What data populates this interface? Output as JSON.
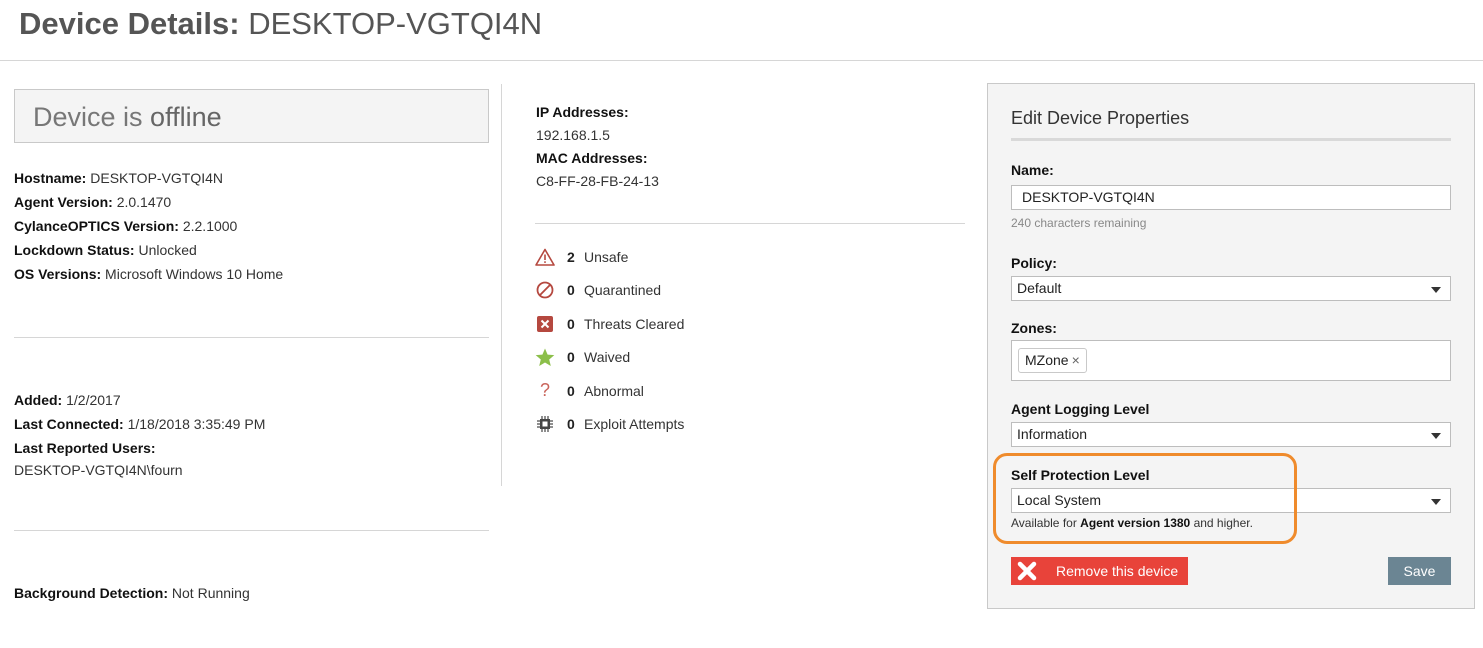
{
  "header": {
    "title_label": "Device Details:",
    "device_name": "DESKTOP-VGTQI4N"
  },
  "status": {
    "prefix": "Device is",
    "state": "offline"
  },
  "info": {
    "hostname_label": "Hostname:",
    "hostname": "DESKTOP-VGTQI4N",
    "agent_version_label": "Agent Version:",
    "agent_version": "2.0.1470",
    "optics_label": "CylanceOPTICS Version:",
    "optics_version": "2.2.1000",
    "lockdown_label": "Lockdown Status:",
    "lockdown_status": "Unlocked",
    "os_label": "OS Versions:",
    "os_version": "Microsoft Windows 10 Home"
  },
  "dates": {
    "added_label": "Added:",
    "added": "1/2/2017",
    "last_connected_label": "Last Connected:",
    "last_connected": "1/18/2018 3:35:49 PM",
    "last_users_label": "Last Reported Users:",
    "last_users": "DESKTOP-VGTQI4N\\fourn"
  },
  "background": {
    "label": "Background Detection:",
    "value": "Not Running"
  },
  "network": {
    "ip_label": "IP Addresses:",
    "ip": "192.168.1.5",
    "mac_label": "MAC Addresses:",
    "mac": "C8-FF-28-FB-24-13"
  },
  "threats": [
    {
      "icon": "warning-triangle-icon",
      "count": "2",
      "label": "Unsafe"
    },
    {
      "icon": "prohibited-icon",
      "count": "0",
      "label": "Quarantined"
    },
    {
      "icon": "x-square-icon",
      "count": "0",
      "label": "Threats Cleared"
    },
    {
      "icon": "star-icon",
      "count": "0",
      "label": "Waived"
    },
    {
      "icon": "question-mark-icon",
      "count": "0",
      "label": "Abnormal"
    },
    {
      "icon": "chip-icon",
      "count": "0",
      "label": "Exploit Attempts"
    }
  ],
  "edit_panel": {
    "title": "Edit Device Properties",
    "name_label": "Name:",
    "name_value": "DESKTOP-VGTQI4N",
    "chars_remaining": "240 characters remaining",
    "policy_label": "Policy:",
    "policy_value": "Default",
    "zones_label": "Zones:",
    "zone_tag": "MZone",
    "zone_remove": "×",
    "logging_label": "Agent Logging Level",
    "logging_value": "Information",
    "self_protection_label": "Self Protection Level",
    "self_protection_value": "Local System",
    "note_prefix": "Available for",
    "note_bold": "Agent version 1380",
    "note_suffix": "and higher.",
    "remove_label": "Remove this device",
    "save_label": "Save"
  },
  "colors": {
    "danger": "#e8433a",
    "save": "#6b8593",
    "highlight": "#ef8b2c",
    "waived_star": "#8cbf4a",
    "threat_red": "#b5483f"
  }
}
